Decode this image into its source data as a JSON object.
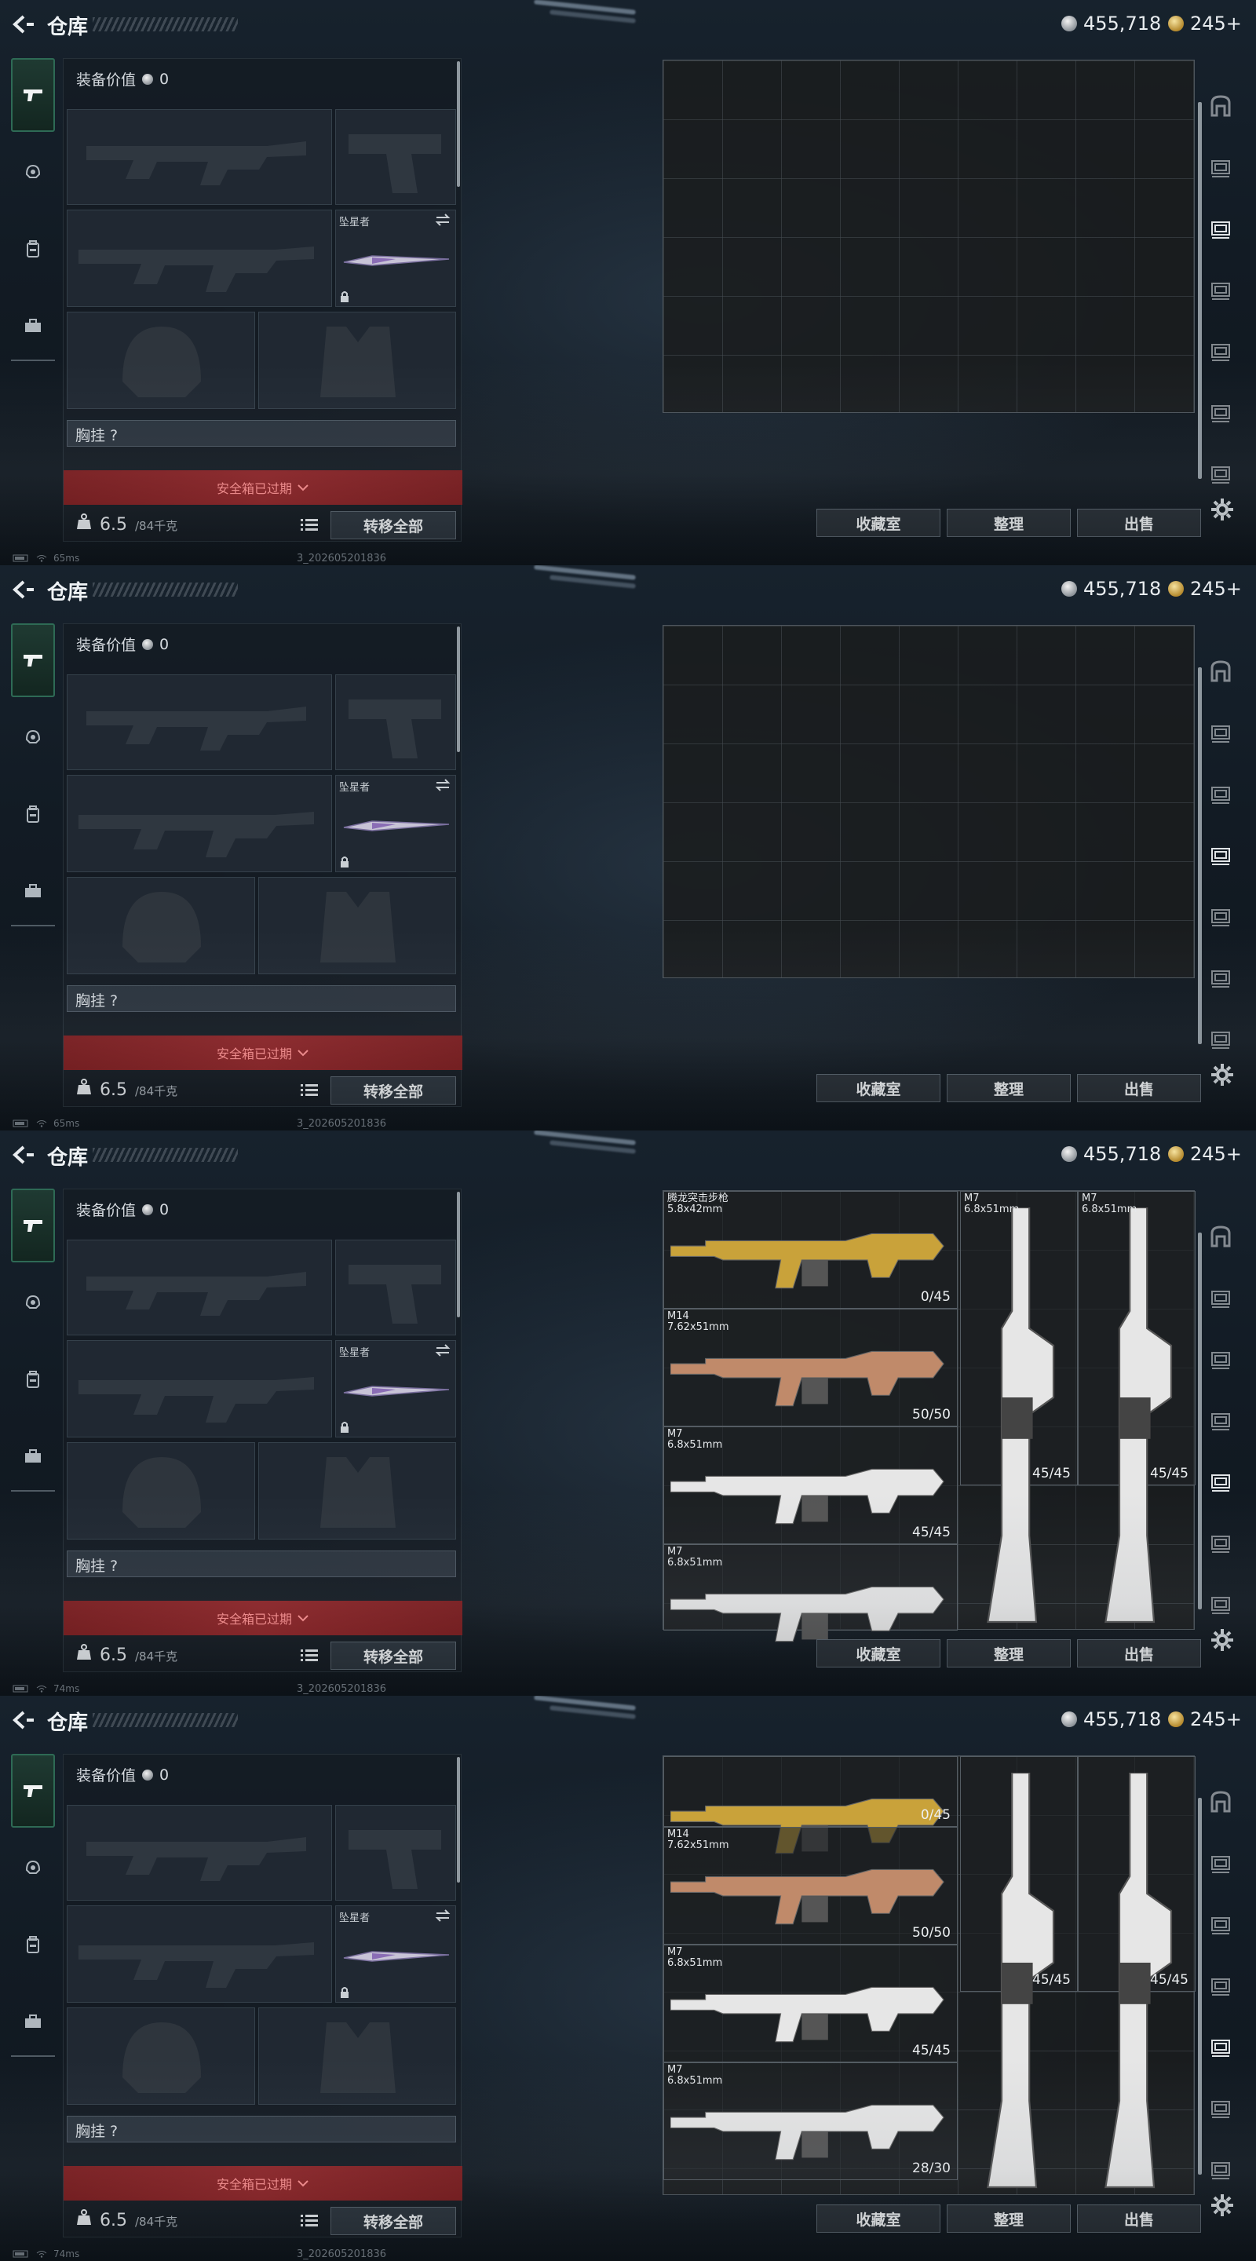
{
  "header": {
    "title": "仓库",
    "silver_amount": "455,718",
    "gold_amount": "245+"
  },
  "equipment": {
    "value_label": "装备价值",
    "value_amount": "0",
    "melee_slot_name": "坠星者",
    "chest_rig_label": "胸挂 ?",
    "safe_box_status": "安全箱已过期",
    "weight_current": "6.5",
    "weight_max": "/84千克",
    "transfer_all": "转移全部"
  },
  "storage_buttons": {
    "collection": "收藏室",
    "organize": "整理",
    "sell": "出售"
  },
  "status_bar": {
    "ping_frames": [
      "65ms",
      "65ms",
      "74ms",
      "74ms"
    ],
    "build_id": "3_202605201836"
  },
  "weapons_frame3": [
    {
      "name": "腾龙突击步枪",
      "caliber": "5.8x42mm",
      "ammo": "0/45",
      "color": "#c9a23a"
    },
    {
      "name": "M14",
      "caliber": "7.62x51mm",
      "ammo": "50/50",
      "color": "#c08a6a"
    },
    {
      "name": "M7",
      "caliber": "6.8x51mm",
      "ammo": "45/45",
      "color": "#e6e6e6"
    },
    {
      "name": "M7",
      "caliber": "6.8x51mm",
      "ammo": "",
      "color": "#e6e6e6"
    },
    {
      "name": "M7",
      "caliber": "6.8x51mm",
      "ammo": "45/45",
      "color": "#e6e6e6"
    },
    {
      "name": "M7",
      "caliber": "6.8x51mm",
      "ammo": "45/45",
      "color": "#e6e6e6"
    }
  ],
  "weapons_frame4": [
    {
      "name": "",
      "caliber": "",
      "ammo": "0/45"
    },
    {
      "name": "M14",
      "caliber": "7.62x51mm",
      "ammo": "50/50"
    },
    {
      "name": "M7",
      "caliber": "6.8x51mm",
      "ammo": "45/45"
    },
    {
      "name": "M7",
      "caliber": "6.8x51mm",
      "ammo": "28/30"
    },
    {
      "name": "",
      "caliber": "",
      "ammo": "45/45"
    },
    {
      "name": "",
      "caliber": "",
      "ammo": "45/45"
    }
  ],
  "active_right_tab": [
    2,
    3,
    4,
    4
  ]
}
